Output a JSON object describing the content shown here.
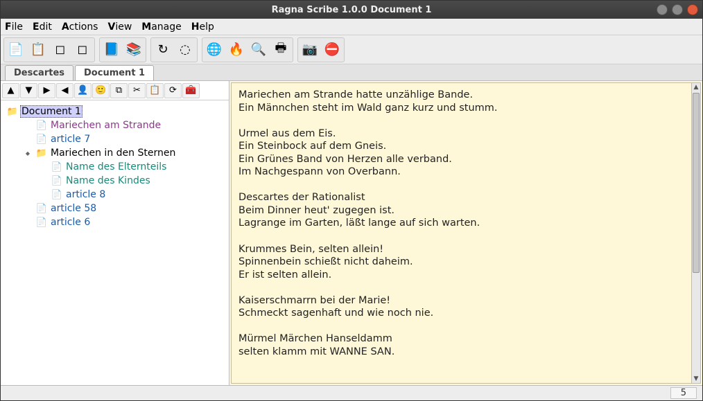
{
  "window": {
    "title": "Ragna Scribe 1.0.0  Document 1"
  },
  "menu": [
    "File",
    "Edit",
    "Actions",
    "View",
    "Manage",
    "Help"
  ],
  "toolbar_groups": [
    [
      {
        "n": "new-doc-icon",
        "g": "📄"
      },
      {
        "n": "note-icon",
        "g": "📋"
      },
      {
        "n": "page-back-icon",
        "g": "◻"
      },
      {
        "n": "page-fwd-icon",
        "g": "◻"
      }
    ],
    [
      {
        "n": "book-blue-icon",
        "g": "📘"
      },
      {
        "n": "books-icon",
        "g": "📚"
      }
    ],
    [
      {
        "n": "refresh-icon",
        "g": "↻"
      },
      {
        "n": "globe-small-icon",
        "g": "◌"
      }
    ],
    [
      {
        "n": "globe-icon",
        "g": "🌐"
      },
      {
        "n": "fire-icon",
        "g": "🔥"
      },
      {
        "n": "search-icon",
        "g": "🔍"
      },
      {
        "n": "print-icon",
        "g": "🖶"
      }
    ],
    [
      {
        "n": "camera-icon",
        "g": "📷"
      },
      {
        "n": "stop-icon",
        "g": "⛔"
      }
    ]
  ],
  "tabs": [
    {
      "label": "Descartes",
      "active": false
    },
    {
      "label": "Document 1",
      "active": true
    }
  ],
  "minitoolbar": [
    {
      "n": "up-icon",
      "g": "▲"
    },
    {
      "n": "down-icon",
      "g": "▼"
    },
    {
      "n": "right-icon",
      "g": "▶"
    },
    {
      "n": "left-icon",
      "g": "◀"
    },
    {
      "n": "user-icon",
      "g": "👤"
    },
    {
      "n": "smiley-icon",
      "g": "🙂"
    },
    {
      "n": "copy-icon",
      "g": "⧉"
    },
    {
      "n": "cut-icon",
      "g": "✂"
    },
    {
      "n": "paste-icon",
      "g": "📋"
    },
    {
      "n": "reload-icon",
      "g": "⟳"
    },
    {
      "n": "toolbox-icon",
      "g": "🧰"
    }
  ],
  "tree": [
    {
      "indent": 0,
      "type": "folder",
      "label": "Document 1",
      "cls": "",
      "selected": true
    },
    {
      "indent": 1,
      "type": "file",
      "label": "Mariechen am Strande",
      "cls": "purple"
    },
    {
      "indent": 1,
      "type": "file",
      "label": "article 7",
      "cls": "blue"
    },
    {
      "indent": 1,
      "type": "folder",
      "label": "Mariechen in den Sternen",
      "cls": "purple",
      "exp": true
    },
    {
      "indent": 2,
      "type": "file",
      "label": "Name des Elternteils",
      "cls": "teal"
    },
    {
      "indent": 2,
      "type": "file",
      "label": "Name des Kindes",
      "cls": "teal"
    },
    {
      "indent": 2,
      "type": "file",
      "label": "article 8",
      "cls": "blue"
    },
    {
      "indent": 1,
      "type": "file",
      "label": "article 58",
      "cls": "blue"
    },
    {
      "indent": 1,
      "type": "file",
      "label": "article 6",
      "cls": "blue"
    }
  ],
  "editor_text": "Mariechen am Strande hatte unzählige Bande.\nEin Männchen steht im Wald ganz kurz und stumm.\n\nUrmel aus dem Eis.\nEin Steinbock auf dem Gneis.\nEin Grünes Band von Herzen alle verband.\nIm Nachgespann von Overbann.\n\nDescartes der Rationalist\nBeim Dinner heut' zugegen ist.\nLagrange im Garten, läßt lange auf sich warten.\n\nKrummes Bein, selten allein!\nSpinnenbein schießt nicht daheim.\nEr ist selten allein.\n\nKaiserschmarrn bei der Marie!\nSchmeckt sagenhaft und wie noch nie.\n\nMürmel Märchen Hanseldamm\nselten klamm mit WANNE SAN.",
  "status": {
    "value": "5"
  }
}
